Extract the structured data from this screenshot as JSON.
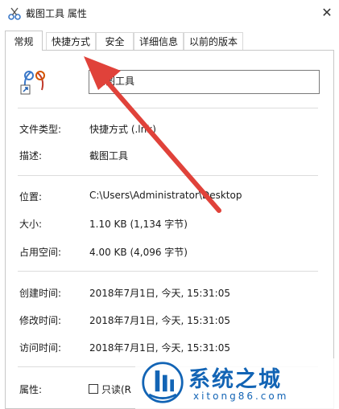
{
  "window": {
    "title": "截图工具 属性",
    "close_glyph": "✕",
    "app_icon": "snipping-tool-icon"
  },
  "tabs": [
    {
      "label": "常规",
      "active": true
    },
    {
      "label": "快捷方式",
      "active": false
    },
    {
      "label": "安全",
      "active": false
    },
    {
      "label": "详细信息",
      "active": false
    },
    {
      "label": "以前的版本",
      "active": false
    }
  ],
  "general": {
    "name": "截图工具",
    "rows": {
      "type": {
        "label": "文件类型:",
        "value": "快捷方式 (.lnk)"
      },
      "desc": {
        "label": "描述:",
        "value": "截图工具"
      },
      "location": {
        "label": "位置:",
        "value": "C:\\Users\\Administrator\\Desktop"
      },
      "size": {
        "label": "大小:",
        "value": "1.10 KB (1,134 字节)"
      },
      "disk": {
        "label": "占用空间:",
        "value": "4.00 KB (4,096 字节)"
      },
      "created": {
        "label": "创建时间:",
        "value": "2018年7月1日, 今天, 15:31:05"
      },
      "modified": {
        "label": "修改时间:",
        "value": "2018年7月1日, 今天, 15:31:05"
      },
      "accessed": {
        "label": "访问时间:",
        "value": "2018年7月1日, 今天, 15:31:05"
      }
    },
    "attributes": {
      "label": "属性:",
      "readonly_label": "只读(R",
      "readonly_checked": false
    }
  },
  "watermark": {
    "title": "系统之城",
    "url": "xitong86.com"
  },
  "colors": {
    "arrow": "#e0423a",
    "watermark": "#1264b5",
    "border": "#c7c7c7"
  }
}
